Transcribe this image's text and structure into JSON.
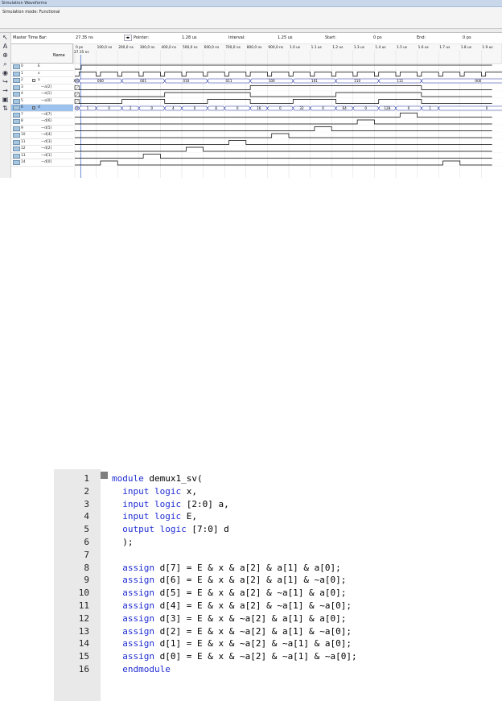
{
  "window": {
    "title": "Simulation Waveforms",
    "mode_label": "Simulation mode: Functional"
  },
  "infobar": {
    "master_time_bar_label": "Master Time Bar:",
    "master_time_bar_value": "27.35 ns",
    "pointer_label": "Pointer:",
    "pointer_value": "1.28 us",
    "interval_label": "Interval:",
    "interval_value": "1.25 us",
    "start_label": "Start:",
    "start_value": "0 ps",
    "end_label": "End:",
    "end_value": "0 ps"
  },
  "name_header": "Name",
  "cursor_label": "27.35 ns",
  "timeline_ticks": [
    "0 ps",
    "100,0 ns",
    "200,0 ns",
    "300,0 ns",
    "400,0 ns",
    "500,0 ns",
    "600,0 ns",
    "700,0 ns",
    "800,0 ns",
    "900,0 ns",
    "1.0 us",
    "1.1 us",
    "1.2 us",
    "1.3 us",
    "1.4 us",
    "1.5 us",
    "1.6 us",
    "1.7 us",
    "1.8 us",
    "1.9 us",
    "2.0"
  ],
  "signals": [
    {
      "idx": "0",
      "name": "E",
      "sub": false,
      "expand": ""
    },
    {
      "idx": "1",
      "name": "x",
      "sub": false,
      "expand": ""
    },
    {
      "idx": "2",
      "name": "a",
      "sub": false,
      "expand": "-"
    },
    {
      "idx": "3",
      "name": "a[2]",
      "sub": true,
      "expand": ""
    },
    {
      "idx": "4",
      "name": "a[1]",
      "sub": true,
      "expand": ""
    },
    {
      "idx": "5",
      "name": "a[0]",
      "sub": true,
      "expand": ""
    },
    {
      "idx": "6",
      "name": "d",
      "sub": false,
      "expand": "-"
    },
    {
      "idx": "7",
      "name": "d[7]",
      "sub": true,
      "expand": ""
    },
    {
      "idx": "8",
      "name": "d[6]",
      "sub": true,
      "expand": ""
    },
    {
      "idx": "9",
      "name": "d[5]",
      "sub": true,
      "expand": ""
    },
    {
      "idx": "10",
      "name": "d[4]",
      "sub": true,
      "expand": ""
    },
    {
      "idx": "11",
      "name": "d[3]",
      "sub": true,
      "expand": ""
    },
    {
      "idx": "12",
      "name": "d[2]",
      "sub": true,
      "expand": ""
    },
    {
      "idx": "13",
      "name": "d[1]",
      "sub": true,
      "expand": ""
    },
    {
      "idx": "14",
      "name": "d[0]",
      "sub": true,
      "expand": ""
    }
  ],
  "bus_a_values": [
    "XXX",
    "000",
    "001",
    "010",
    "011",
    "100",
    "101",
    "110",
    "111",
    "000"
  ],
  "bus_d_values": [
    "0",
    "1",
    "0",
    "2",
    "0",
    "4",
    "0",
    "8",
    "0",
    "16",
    "0",
    "32",
    "0",
    "64",
    "0",
    "128",
    "0",
    "1",
    "0"
  ],
  "code": {
    "lines": [
      {
        "n": "1",
        "text": "module demux1_sv(",
        "kw": [
          "module"
        ]
      },
      {
        "n": "2",
        "text": "  input logic x,",
        "kw": [
          "input",
          "logic"
        ]
      },
      {
        "n": "3",
        "text": "  input logic [2:0] a,",
        "kw": [
          "input",
          "logic"
        ]
      },
      {
        "n": "4",
        "text": "  input logic E,",
        "kw": [
          "input",
          "logic"
        ]
      },
      {
        "n": "5",
        "text": "  output logic [7:0] d",
        "kw": [
          "output",
          "logic"
        ]
      },
      {
        "n": "6",
        "text": "  );",
        "kw": []
      },
      {
        "n": "7",
        "text": "",
        "kw": []
      },
      {
        "n": "8",
        "text": "  assign d[7] = E & x & a[2] & a[1] & a[0];",
        "kw": [
          "assign"
        ]
      },
      {
        "n": "9",
        "text": "  assign d[6] = E & x & a[2] & a[1] & ~a[0];",
        "kw": [
          "assign"
        ]
      },
      {
        "n": "10",
        "text": "  assign d[5] = E & x & a[2] & ~a[1] & a[0];",
        "kw": [
          "assign"
        ]
      },
      {
        "n": "11",
        "text": "  assign d[4] = E & x & a[2] & ~a[1] & ~a[0];",
        "kw": [
          "assign"
        ]
      },
      {
        "n": "12",
        "text": "  assign d[3] = E & x & ~a[2] & a[1] & a[0];",
        "kw": [
          "assign"
        ]
      },
      {
        "n": "13",
        "text": "  assign d[2] = E & x & ~a[2] & a[1] & ~a[0];",
        "kw": [
          "assign"
        ]
      },
      {
        "n": "14",
        "text": "  assign d[1] = E & x & ~a[2] & ~a[1] & a[0];",
        "kw": [
          "assign"
        ]
      },
      {
        "n": "15",
        "text": "  assign d[0] = E & x & ~a[2] & ~a[1] & ~a[0];",
        "kw": [
          "assign"
        ]
      },
      {
        "n": "16",
        "text": "  endmodule",
        "kw": [
          "endmodule"
        ]
      }
    ]
  },
  "tools": [
    "pointer-icon",
    "text-icon",
    "zoom-icon",
    "zoom-in-icon",
    "find-icon",
    "replace-icon",
    "waveform-icon",
    "node-icon",
    "sort-icon"
  ]
}
